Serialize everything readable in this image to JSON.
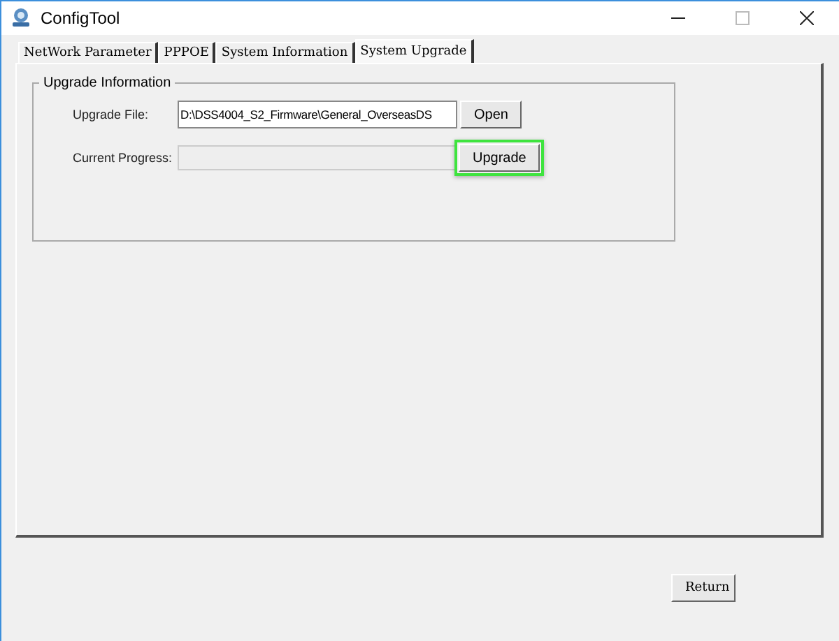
{
  "window": {
    "title": "ConfigTool"
  },
  "tabs": [
    {
      "label": "NetWork Parameter",
      "selected": false
    },
    {
      "label": "PPPOE",
      "selected": false
    },
    {
      "label": "System Information",
      "selected": false
    },
    {
      "label": "System Upgrade",
      "selected": true
    }
  ],
  "group": {
    "title": "Upgrade Information",
    "upgrade_file": {
      "label": "Upgrade File:",
      "value": "D:\\DSS4004_S2_Firmware\\General_OverseasDS",
      "button": "Open"
    },
    "current_progress": {
      "label": "Current Progress:",
      "button": "Upgrade",
      "highlighted": true
    }
  },
  "buttons": [
    {
      "label": "Return"
    }
  ]
}
